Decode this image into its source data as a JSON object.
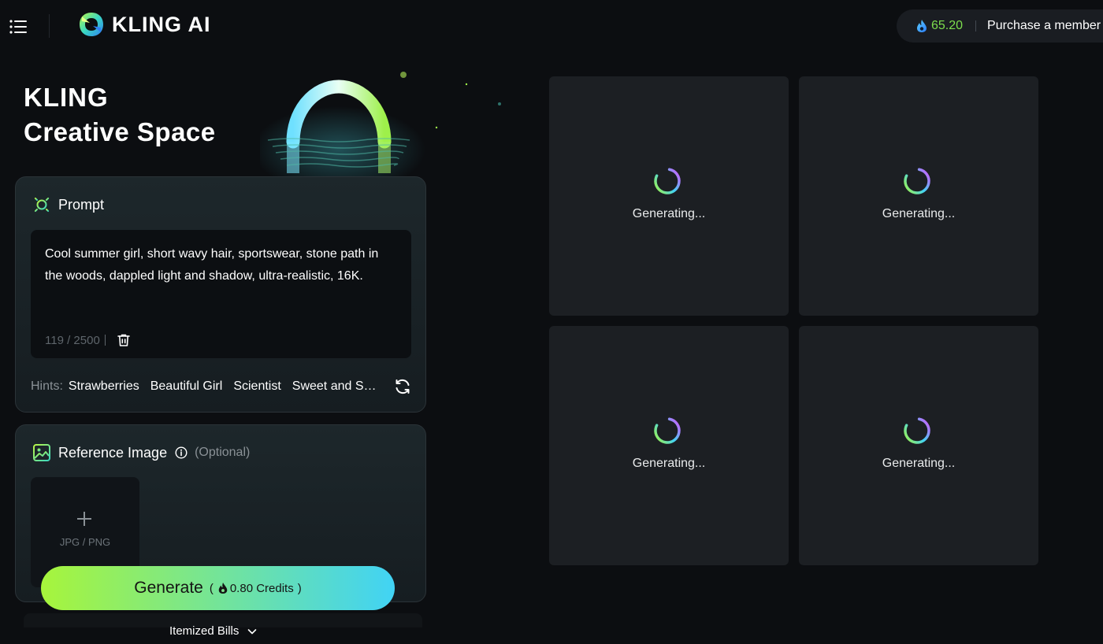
{
  "header": {
    "brand": "KLING AI",
    "credits": "65.20",
    "purchase_label": "Purchase a member"
  },
  "hero": {
    "line1": "KLING",
    "line2": "Creative Space"
  },
  "prompt": {
    "title": "Prompt",
    "text": "Cool summer girl, short wavy hair, sportswear, stone path in the woods, dappled light and shadow, ultra-realistic, 16K.",
    "char_count": "119 / 2500",
    "hints_label": "Hints:",
    "hints": [
      "Strawberries",
      "Beautiful Girl",
      "Scientist",
      "Sweet and Sour"
    ]
  },
  "reference": {
    "title": "Reference Image",
    "optional": "(Optional)",
    "upload_label": "JPG / PNG"
  },
  "generate": {
    "label": "Generate",
    "cost_open": "(",
    "cost": "0.80 Credits",
    "cost_close": ")"
  },
  "bills": {
    "label": "Itemized Bills"
  },
  "results": [
    {
      "status": "Generating..."
    },
    {
      "status": "Generating..."
    },
    {
      "status": "Generating..."
    },
    {
      "status": "Generating..."
    }
  ],
  "colors": {
    "background": "#0c0e11",
    "accent_green": "#a7f53b",
    "accent_blue": "#41d3f5",
    "credit_green": "#7dde4d",
    "card": "#1c1f23"
  },
  "icons": {
    "menu": "menu-icon",
    "logo": "kling-logo-icon",
    "credit": "drop-icon",
    "prompt": "sun-icon",
    "reference": "image-icon",
    "info": "info-icon",
    "trash": "trash-icon",
    "refresh": "refresh-icon",
    "upload": "plus-icon",
    "bills": "chevron-down-icon",
    "loading": "spinner-icon"
  }
}
